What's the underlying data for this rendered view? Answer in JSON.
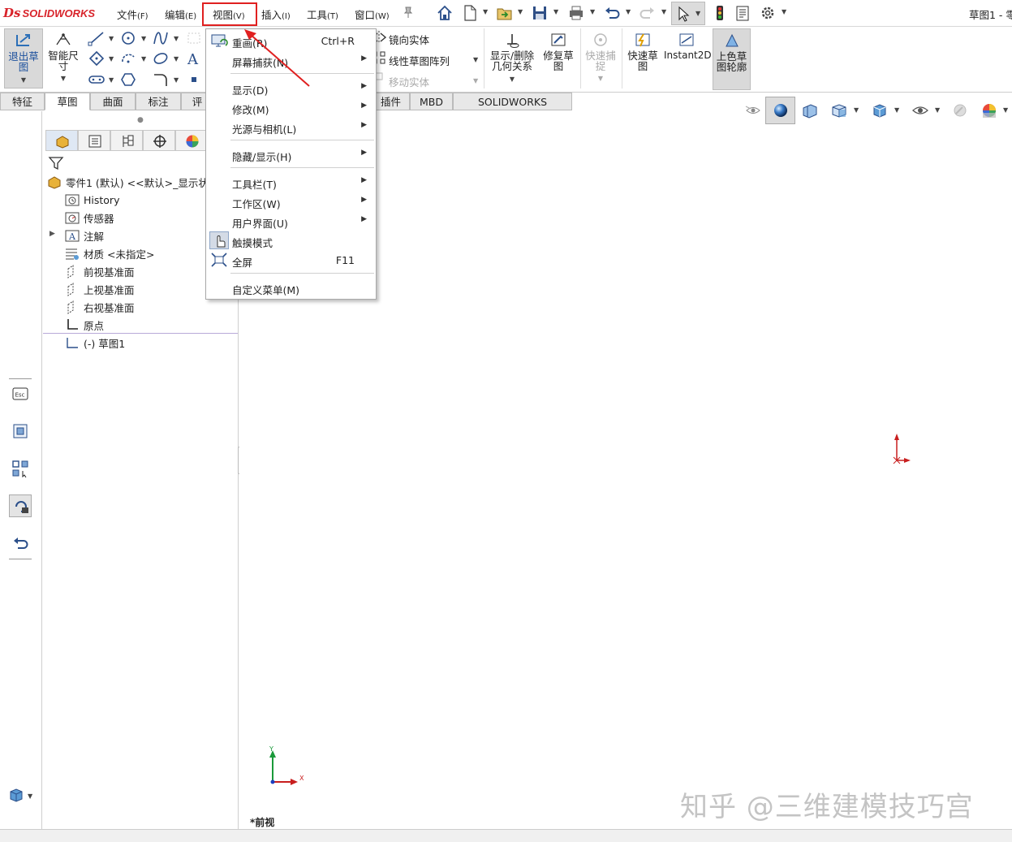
{
  "app": {
    "logo_ds": "Ds",
    "logo_text": "SOLIDWORKS",
    "doc_title": "草图1 - 零"
  },
  "menubar": [
    {
      "label": "文件",
      "key": "(F)"
    },
    {
      "label": "编辑",
      "key": "(E)"
    },
    {
      "label": "视图",
      "key": "(V)"
    },
    {
      "label": "插入",
      "key": "(I)"
    },
    {
      "label": "工具",
      "key": "(T)"
    },
    {
      "label": "窗口",
      "key": "(W)"
    }
  ],
  "quick_access_icons": [
    "pin-icon",
    "home-icon",
    "new-document-icon",
    "open-icon",
    "save-icon",
    "print-icon",
    "undo-icon",
    "redo-icon",
    "select-pointer-icon",
    "traffic-light-icon",
    "file-properties-icon",
    "options-gear-icon"
  ],
  "command_manager": {
    "exit_sketch": "退出草图",
    "smart_dimension": "智能尺寸",
    "mirror_entities": "镜向实体",
    "linear_pattern": "线性草图阵列",
    "move_entities": "移动实体",
    "display_delete_relations": "显示/删除几何关系",
    "repair_sketch": "修复草图",
    "quick_snaps": "快速捕捉",
    "rapid_sketch": "快速草图",
    "instant2d": "Instant2D",
    "shaded_contours": "上色草图轮廓"
  },
  "tabs": [
    "特征",
    "草图",
    "曲面",
    "标注",
    "评",
    "插件",
    "MBD",
    "SOLIDWORKS Inspection"
  ],
  "selected_tab": "草图",
  "feature_tree": {
    "root": "零件1 (默认) <<默认>_显示状态",
    "items": [
      "History",
      "传感器",
      "注解",
      "材质 <未指定>",
      "前视基准面",
      "上视基准面",
      "右视基准面",
      "原点",
      "(-) 草图1"
    ]
  },
  "view_menu": {
    "items": [
      {
        "label": "重画(R)",
        "shortcut": "Ctrl+R"
      },
      {
        "label": "屏幕捕获(N)",
        "submenu": true
      },
      {
        "label": "显示(D)",
        "submenu": true
      },
      {
        "label": "修改(M)",
        "submenu": true
      },
      {
        "label": "光源与相机(L)",
        "submenu": true
      },
      {
        "label": "隐藏/显示(H)",
        "submenu": true
      },
      {
        "label": "工具栏(T)",
        "submenu": true
      },
      {
        "label": "工作区(W)",
        "submenu": true
      },
      {
        "label": "用户界面(U)",
        "submenu": true
      },
      {
        "label": "触摸模式"
      },
      {
        "label": "全屏",
        "shortcut": "F11"
      },
      {
        "label": "自定义菜单(M)"
      }
    ]
  },
  "viewport": {
    "view_name": "*前视",
    "triad_x": "X",
    "triad_y": "Y",
    "watermark": "知乎 @三维建模技巧宫"
  },
  "colors": {
    "accent_red": "#e02020",
    "logo_red": "#d8232a",
    "origin_red": "#c81e1e",
    "triad_green": "#1a9a3a",
    "triad_blue": "#1c3fbf"
  }
}
